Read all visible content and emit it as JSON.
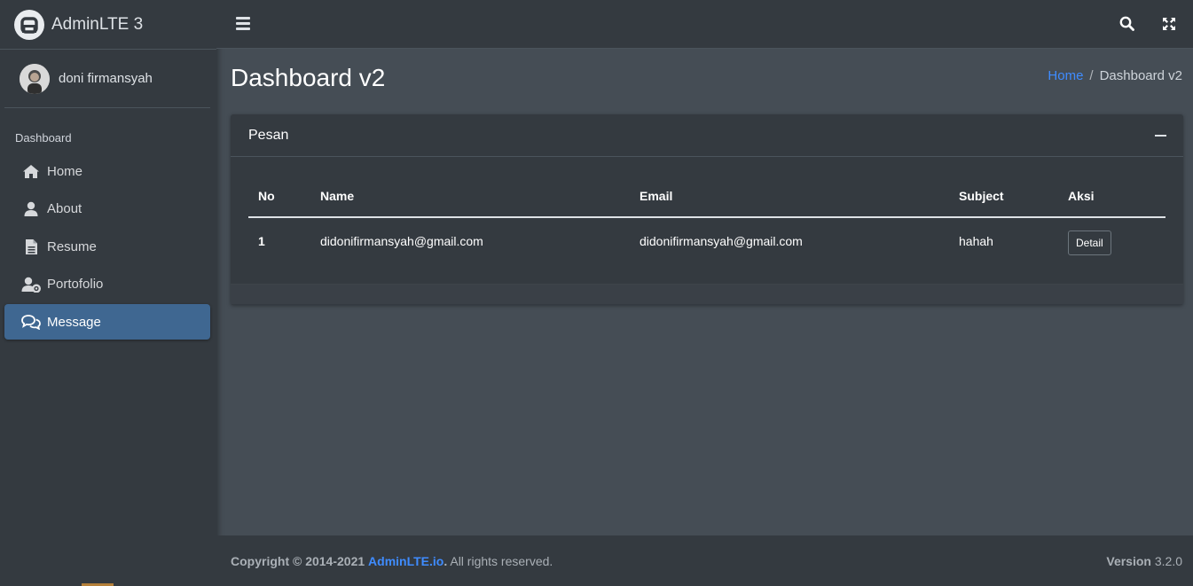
{
  "brand": {
    "name": "AdminLTE 3"
  },
  "user": {
    "name": "doni firmansyah"
  },
  "sidebar": {
    "header": "Dashboard",
    "items": [
      {
        "label": "Home",
        "icon": "home-icon"
      },
      {
        "label": "About",
        "icon": "user-icon"
      },
      {
        "label": "Resume",
        "icon": "file-icon"
      },
      {
        "label": "Portofolio",
        "icon": "user-cog-icon"
      },
      {
        "label": "Message",
        "icon": "comments-icon",
        "active": true
      }
    ]
  },
  "page": {
    "title": "Dashboard v2",
    "breadcrumb": {
      "home": "Home",
      "separator": "/",
      "current": "Dashboard v2"
    }
  },
  "card": {
    "title": "Pesan",
    "table": {
      "columns": [
        "No",
        "Name",
        "Email",
        "Subject",
        "Aksi"
      ],
      "rows": [
        {
          "no": "1",
          "name": "didonifirmansyah@gmail.com",
          "email": "didonifirmansyah@gmail.com",
          "subject": "hahah",
          "action": "Detail"
        }
      ]
    }
  },
  "footer": {
    "copyright": "Copyright © 2014-2021",
    "brand_link": "AdminLTE.io",
    "period": ".",
    "rights": " All rights reserved.",
    "version_label": "Version",
    "version": "3.2.0"
  },
  "colors": {
    "accent": "#3f8cff",
    "active_nav": "#3f6791",
    "sidebar_bg": "#343a40",
    "content_bg": "#454d55"
  }
}
